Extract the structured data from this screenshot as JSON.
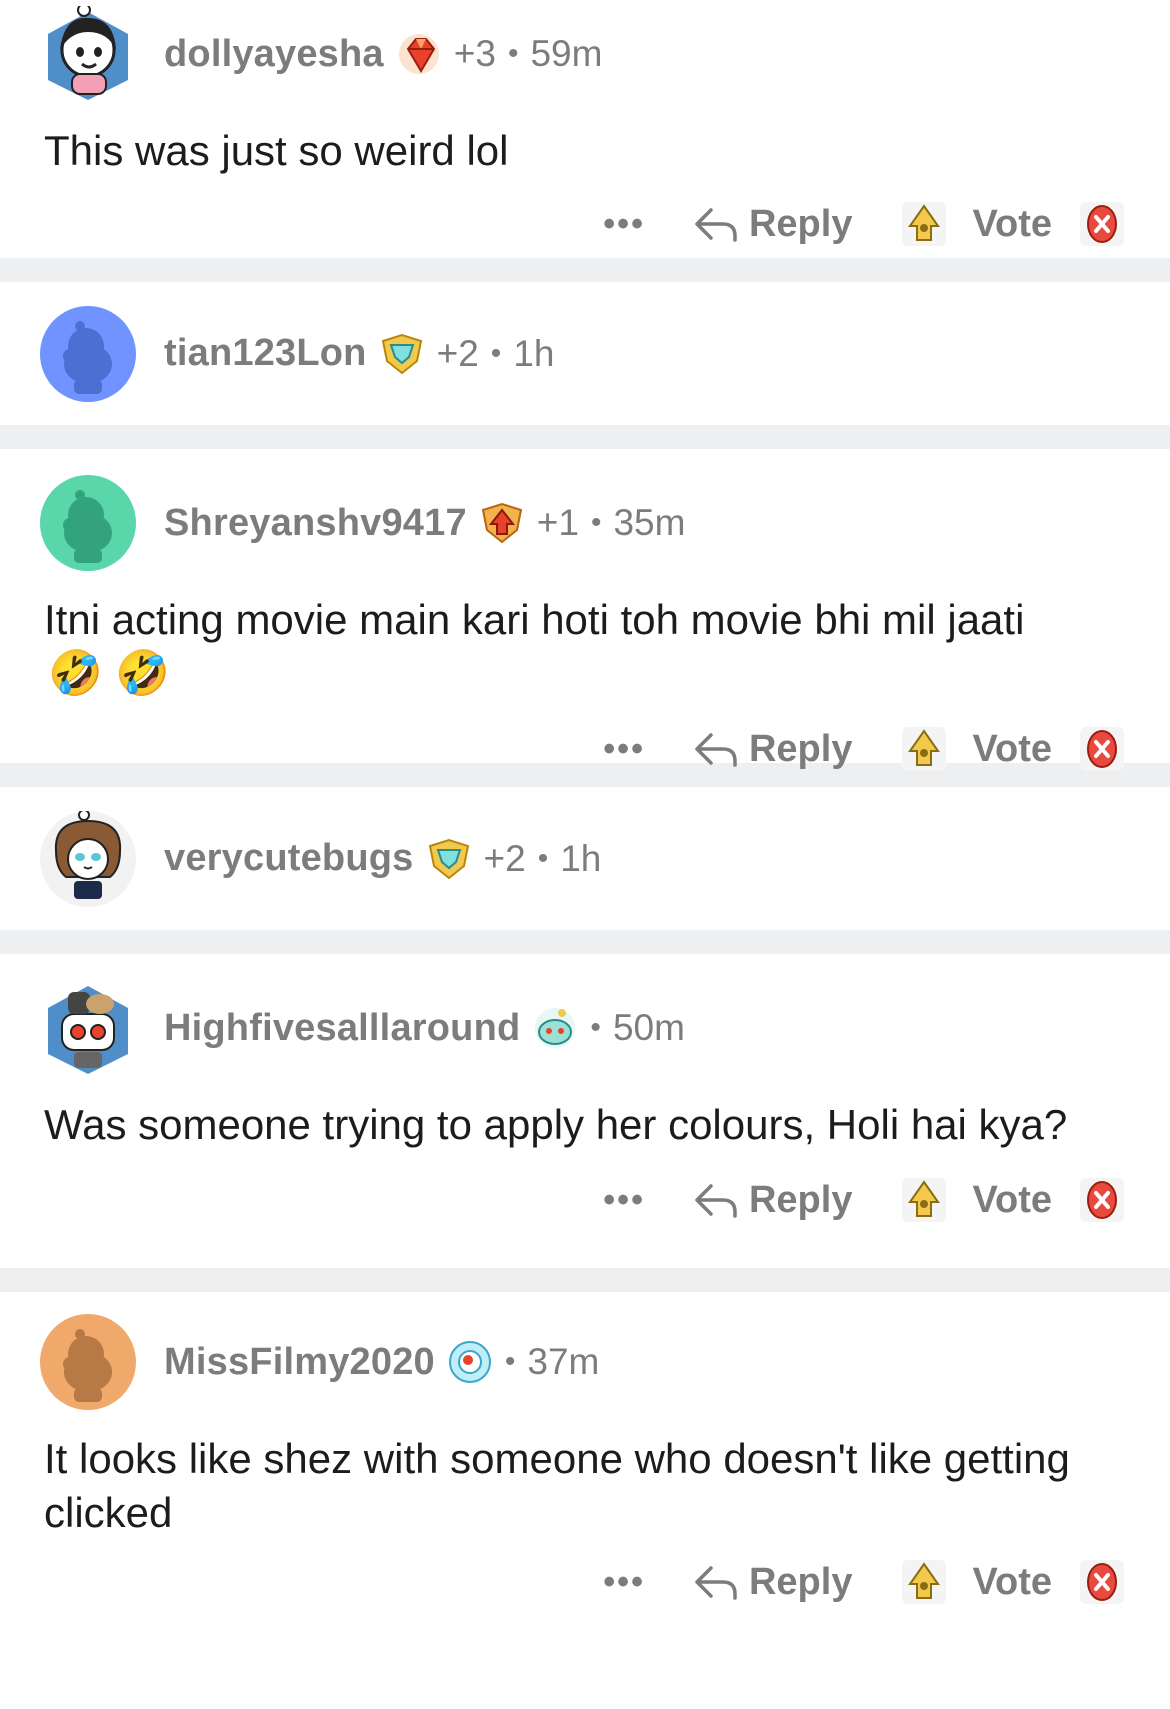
{
  "actions": {
    "more_label": "•••",
    "reply_label": "Reply",
    "vote_label": "Vote"
  },
  "comments": [
    {
      "username": "dollyayesha",
      "flair_icon": "ruby-gem-icon",
      "awards": "+3",
      "age": "59m",
      "text": "This was just so weird lol",
      "emojis": "",
      "has_actions": true,
      "avatar": "custom-girl-avatar",
      "avatar_bg": "#ffffff"
    },
    {
      "username": "tian123Lon",
      "flair_icon": "diamond-shield-icon",
      "awards": "+2",
      "age": "1h",
      "text": "",
      "emojis": "",
      "has_actions": false,
      "avatar": "snoo-blue-avatar",
      "avatar_bg": "#7193ff"
    },
    {
      "username": "Shreyanshv9417",
      "flair_icon": "arrow-shield-icon",
      "awards": "+1",
      "age": "35m",
      "text": "Itni acting movie main kari hoti toh movie bhi mil jaati",
      "emojis": "🤣 🤣",
      "has_actions": true,
      "avatar": "snoo-green-avatar",
      "avatar_bg": "#59d6aa"
    },
    {
      "username": "verycutebugs",
      "flair_icon": "diamond-shield-icon",
      "awards": "+2",
      "age": "1h",
      "text": "",
      "emojis": "",
      "has_actions": false,
      "avatar": "custom-owl-avatar",
      "avatar_bg": "#f2f2f2"
    },
    {
      "username": "Highfivesalllaround",
      "flair_icon": "snoo-face-icon",
      "awards": "",
      "age": "50m",
      "text": "Was someone trying to apply her colours,  Holi hai kya?",
      "emojis": "",
      "has_actions": true,
      "avatar": "custom-robot-avatar",
      "avatar_bg": "#ffffff"
    },
    {
      "username": "MissFilmy2020",
      "flair_icon": "eye-orb-icon",
      "awards": "",
      "age": "37m",
      "text": "It looks like shez with someone who doesn't like getting clicked",
      "emojis": "",
      "has_actions": true,
      "avatar": "snoo-orange-avatar",
      "avatar_bg": "#f0a96b"
    }
  ],
  "colors": {
    "meta_gray": "#7c7c7c",
    "divider": "#edeff1",
    "text": "#1c1c1c",
    "downvote_red": "#e84a3f",
    "upvote_gold": "#f2c94c"
  }
}
